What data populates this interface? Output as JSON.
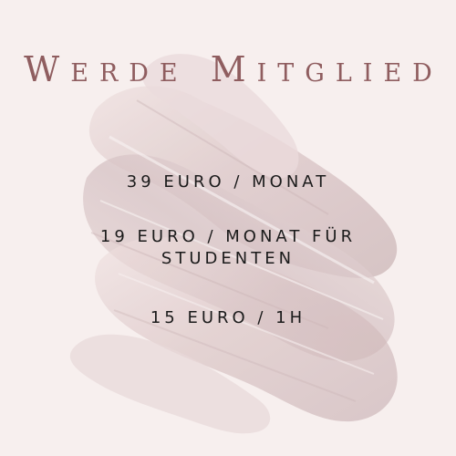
{
  "title": "Werde Mitglied",
  "prices": [
    {
      "text": "39 EURO / MONAT"
    },
    {
      "text": "19 EURO / MONAT FÜR STUDENTEN"
    },
    {
      "text": "15 EURO / 1H"
    }
  ],
  "colors": {
    "background": "#f7efee",
    "brush": "#d9c3c4",
    "title": "#8f5d5f",
    "text": "#1b1b1b"
  },
  "decorations": {
    "brush_texture": "rose-paint-brush"
  }
}
